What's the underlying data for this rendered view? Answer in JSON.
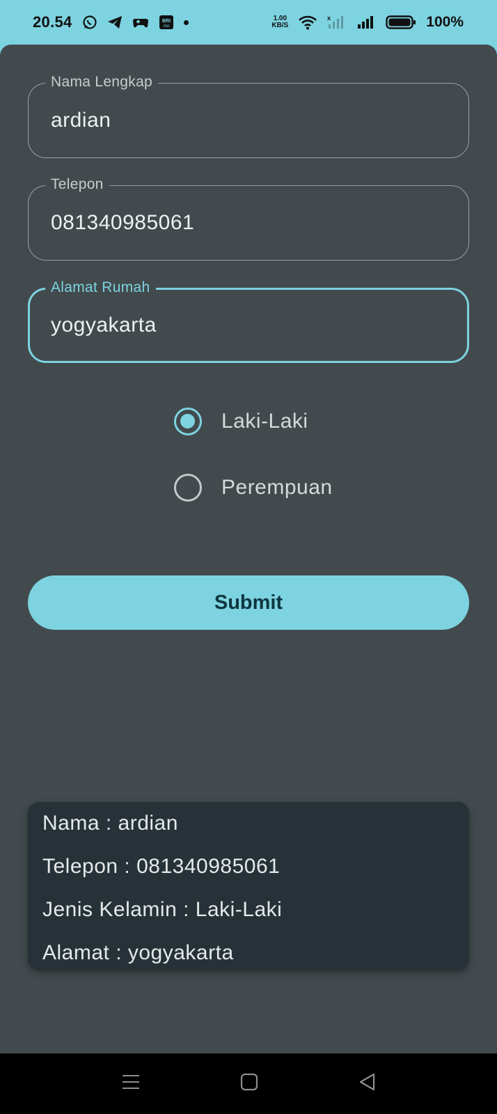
{
  "status_bar": {
    "time": "20.54",
    "network_speed_value": "1.00",
    "network_speed_unit": "KB/S",
    "battery": "100%",
    "icons": [
      "whatsapp-icon",
      "telegram-icon",
      "game-controller-icon",
      "brimo-icon",
      "notification-dot-icon",
      "wifi-icon",
      "signal-no-sim-icon",
      "signal-icon",
      "battery-icon"
    ]
  },
  "form": {
    "name": {
      "label": "Nama Lengkap",
      "value": "ardian"
    },
    "phone": {
      "label": "Telepon",
      "value": "081340985061"
    },
    "address": {
      "label": "Alamat Rumah",
      "value": "yogyakarta"
    },
    "gender": {
      "options": [
        {
          "label": "Laki-Laki",
          "checked": true
        },
        {
          "label": "Perempuan",
          "checked": false
        }
      ]
    },
    "submit_label": "Submit"
  },
  "result": {
    "name_line": "Nama : ardian",
    "phone_line": "Telepon : 081340985061",
    "gender_line": "Jenis Kelamin : Laki-Laki",
    "address_line": "Alamat : yogyakarta"
  },
  "colors": {
    "accent": "#7dd3e0",
    "background": "#424a4d",
    "card": "#263237"
  },
  "nav_bar": {
    "icons": [
      "menu-icon",
      "home-icon",
      "back-icon"
    ]
  }
}
